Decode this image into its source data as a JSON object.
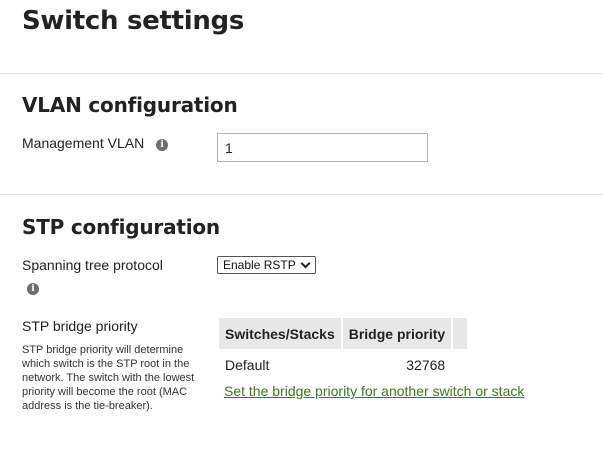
{
  "page": {
    "title": "Switch settings"
  },
  "vlan": {
    "heading": "VLAN configuration",
    "management_label": "Management VLAN",
    "management_value": "1"
  },
  "stp": {
    "heading": "STP configuration",
    "protocol_label": "Spanning tree protocol",
    "protocol_selected": "Enable RSTP",
    "priority_label": "STP bridge priority",
    "priority_description": "STP bridge priority will determine which switch is the STP root in the network. The switch with the lowest priority will become the root (MAC address is the tie-breaker).",
    "table": {
      "columns": [
        "Switches/Stacks",
        "Bridge priority"
      ],
      "rows": [
        {
          "switch": "Default",
          "priority": "32768"
        }
      ]
    },
    "add_link": "Set the bridge priority for another switch or stack"
  },
  "icons": {
    "info": "info-icon"
  },
  "colors": {
    "link": "#3b7a1e",
    "table_header_bg": "#e8e8e8"
  }
}
